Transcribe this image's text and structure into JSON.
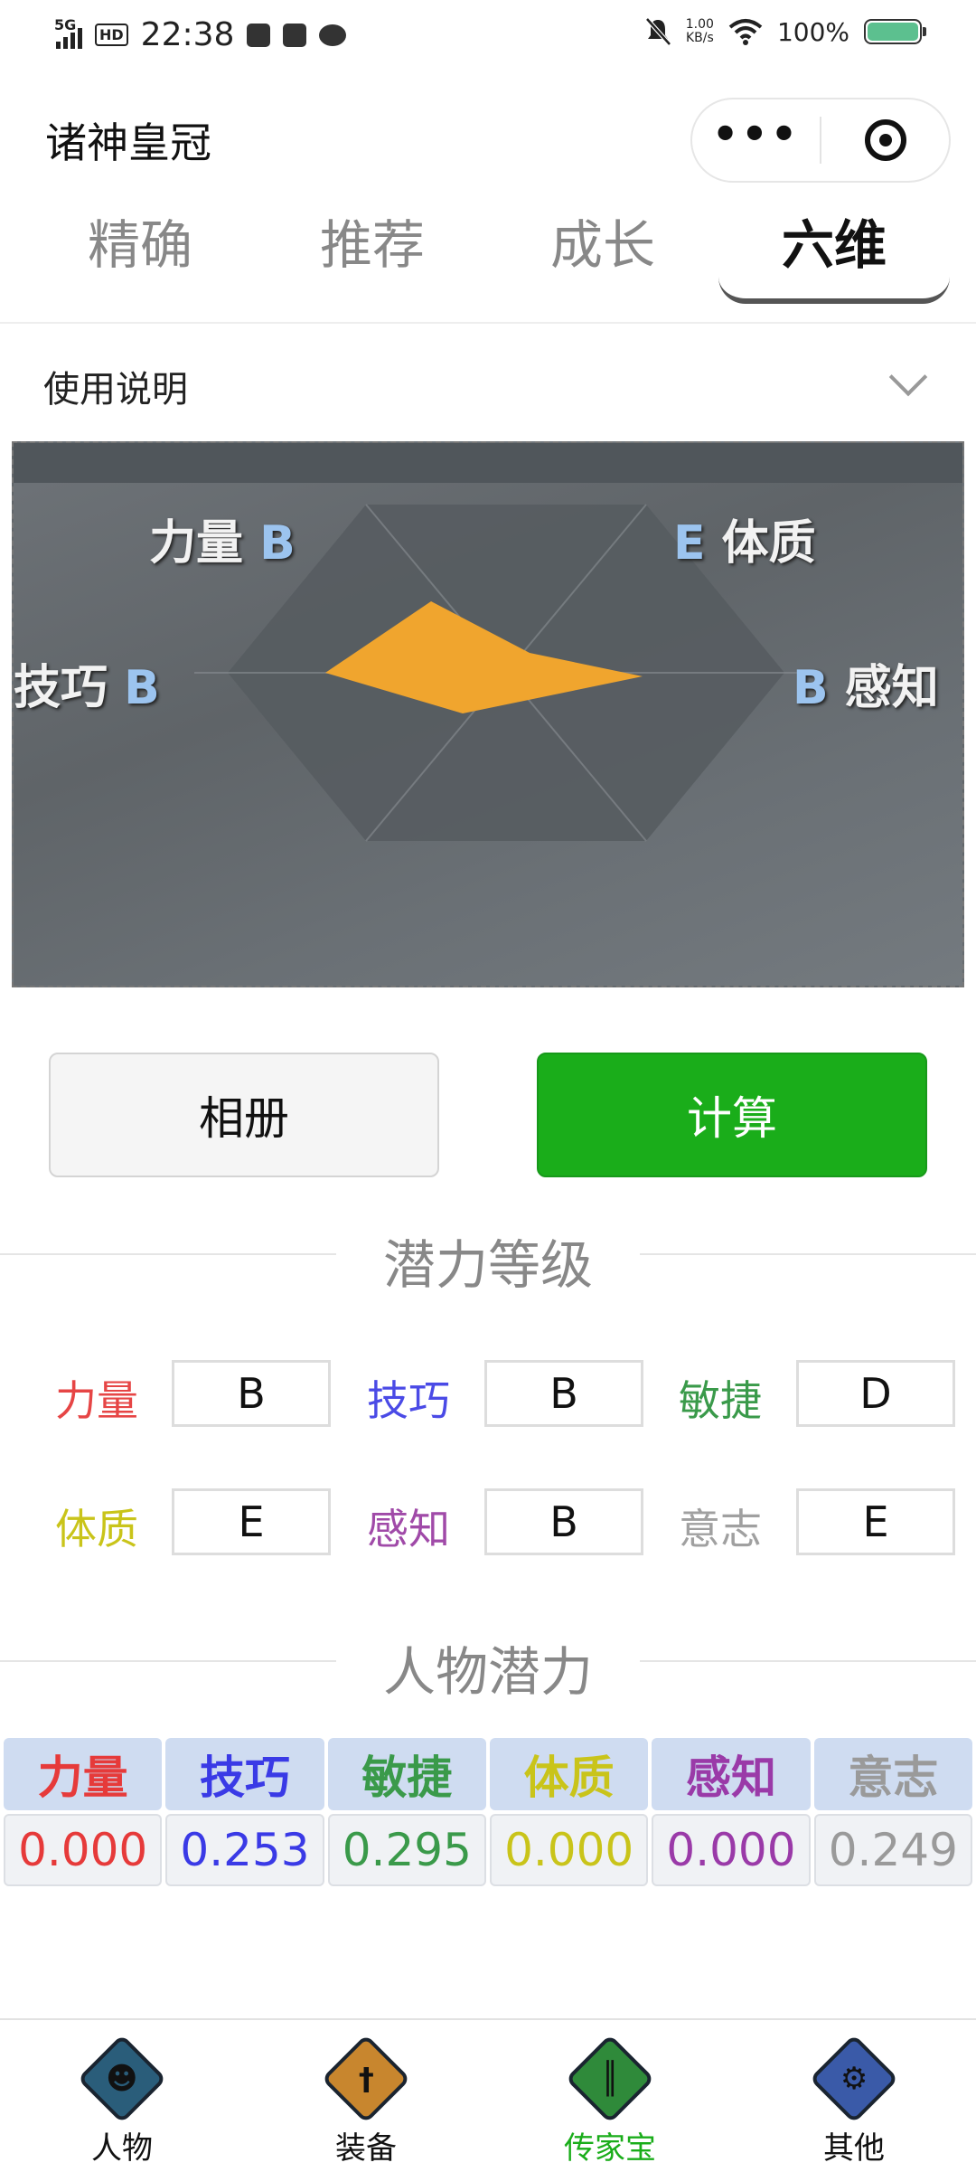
{
  "status_bar": {
    "network": "5G",
    "hd": "HD",
    "time": "22:38",
    "speed_value": "1.00",
    "speed_unit": "KB/s",
    "battery": "100%"
  },
  "header": {
    "title": "诸神皇冠",
    "more_label": "•••"
  },
  "tabs": [
    {
      "label": "精确",
      "active": false
    },
    {
      "label": "推荐",
      "active": false
    },
    {
      "label": "成长",
      "active": false
    },
    {
      "label": "六维",
      "active": true
    }
  ],
  "usage": {
    "label": "使用说明"
  },
  "screenshot": {
    "labels": {
      "strength": "力量",
      "constitution": "体质",
      "skill": "技巧",
      "perception": "感知"
    },
    "grades": {
      "strength": "B",
      "constitution": "E",
      "skill": "B",
      "perception": "B"
    },
    "shape_color": "#f0a52e"
  },
  "buttons": {
    "album": "相册",
    "calculate": "计算"
  },
  "potential_grade": {
    "title": "潜力等级",
    "items": [
      {
        "label": "力量",
        "value": "B",
        "color": "#e64545"
      },
      {
        "label": "技巧",
        "value": "B",
        "color": "#4a4ae6"
      },
      {
        "label": "敏捷",
        "value": "D",
        "color": "#3a9a4a"
      },
      {
        "label": "体质",
        "value": "E",
        "color": "#c9c41a"
      },
      {
        "label": "感知",
        "value": "B",
        "color": "#a04aa8"
      },
      {
        "label": "意志",
        "value": "E",
        "color": "#a0a0a0"
      }
    ]
  },
  "character_potential": {
    "title": "人物潜力",
    "columns": [
      {
        "label": "力量",
        "value": "0.000",
        "color": "#e63a3a"
      },
      {
        "label": "技巧",
        "value": "0.253",
        "color": "#3a3ae6"
      },
      {
        "label": "敏捷",
        "value": "0.295",
        "color": "#3a9a4a"
      },
      {
        "label": "体质",
        "value": "0.000",
        "color": "#c9c41a"
      },
      {
        "label": "感知",
        "value": "0.000",
        "color": "#9a3aa8"
      },
      {
        "label": "意志",
        "value": "0.249",
        "color": "#9a9a9a"
      }
    ]
  },
  "bottom_nav": [
    {
      "label": "人物",
      "icon": "character-icon",
      "color": "#2a5d7a",
      "active": false
    },
    {
      "label": "装备",
      "icon": "equipment-icon",
      "color": "#c8862e",
      "active": false
    },
    {
      "label": "传家宝",
      "icon": "heirloom-icon",
      "color": "#2f8a3a",
      "active": true
    },
    {
      "label": "其他",
      "icon": "settings-icon",
      "color": "#3a5aa8",
      "active": false
    }
  ]
}
